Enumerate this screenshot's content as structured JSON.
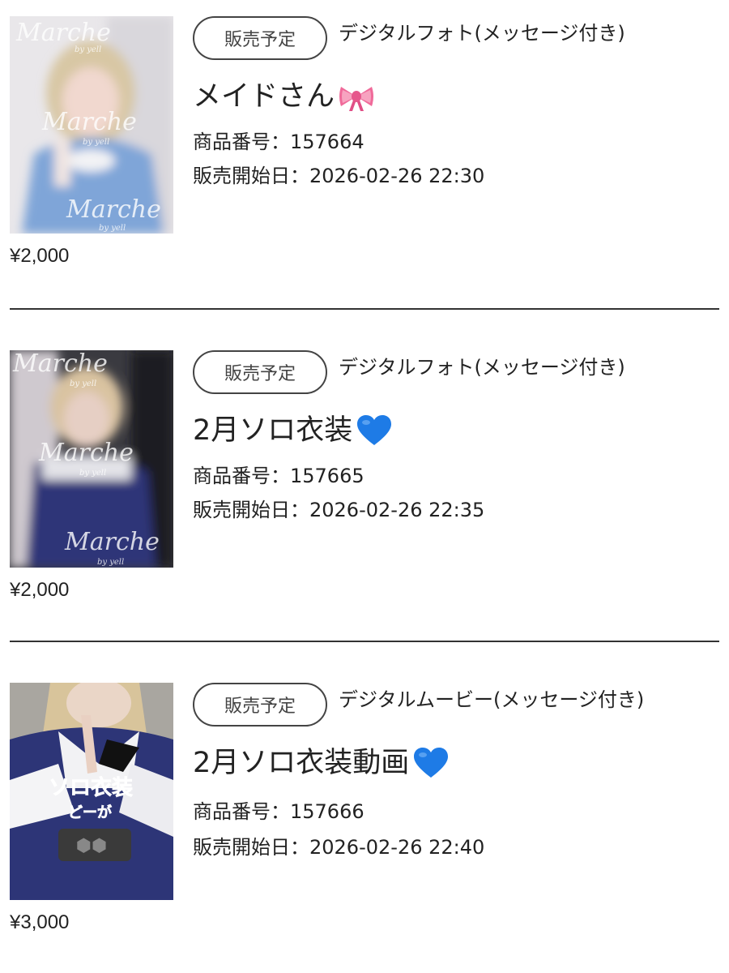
{
  "products": [
    {
      "badge": "販売予定",
      "category": "デジタルフォト(メッセージ付き)",
      "title": "メイドさん",
      "title_emoji": "ribbon-icon",
      "product_no_label": "商品番号：",
      "product_no": "157664",
      "sale_start_label": "販売開始日：",
      "sale_start": "2026-02-26 22:30",
      "price": "¥2,000",
      "watermark": "Marche",
      "watermark_sub": "by yell"
    },
    {
      "badge": "販売予定",
      "category": "デジタルフォト(メッセージ付き)",
      "title": "2月ソロ衣装",
      "title_emoji": "blue-heart-icon",
      "product_no_label": "商品番号：",
      "product_no": "157665",
      "sale_start_label": "販売開始日：",
      "sale_start": "2026-02-26 22:35",
      "price": "¥2,000",
      "watermark": "Marche",
      "watermark_sub": "by yell"
    },
    {
      "badge": "販売予定",
      "category": "デジタルムービー(メッセージ付き)",
      "title": "2月ソロ衣装動画",
      "title_emoji": "blue-heart-icon",
      "product_no_label": "商品番号：",
      "product_no": "157666",
      "sale_start_label": "販売開始日：",
      "sale_start": "2026-02-26 22:40",
      "price": "¥3,000",
      "overlay_text": "ソロ衣装",
      "overlay_sub": "どーが"
    }
  ]
}
